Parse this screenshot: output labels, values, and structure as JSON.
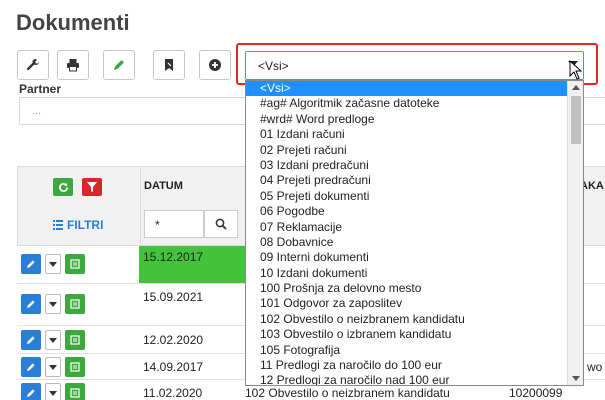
{
  "page": {
    "title": "Dokumenti"
  },
  "toolbar": {
    "buttons": [
      {
        "name": "wrench-icon",
        "color": "#333333"
      },
      {
        "name": "print-icon",
        "color": "#333333"
      },
      {
        "name": "pencil-icon",
        "color": "#3ea83f"
      },
      {
        "name": "bookmark-icon",
        "color": "#333333"
      },
      {
        "name": "plus-circle-icon",
        "color": "#333333"
      }
    ]
  },
  "filters": {
    "partner_label": "Partner",
    "partner_placeholder": "...",
    "doc_type_selected": "<Vsi>"
  },
  "dropdown": {
    "options": [
      "<Vsi>",
      "#ag# Algoritmik začasne datoteke",
      "#wrd# Word predloge",
      "01 Izdani računi",
      "02 Prejeti računi",
      "03 Izdani predračuni",
      "04 Prejeti predračuni",
      "05 Prejeti dokumenti",
      "06 Pogodbe",
      "07 Reklamacije",
      "08 Dobavnice",
      "09 Interni dokumenti",
      "10 Izdani dokumenti",
      "100 Prošnja za delovno mesto",
      "101 Odgovor za zaposlitev",
      "102 Obvestilo o neizbranem kandidatu",
      "103 Obvestilo o izbranem kandidatu",
      "105 Fotografija",
      "11 Predlogi za naročilo do 100 eur",
      "12 Predlogi za naročilo nad 100 eur"
    ],
    "selected_index": 0
  },
  "grid": {
    "filtri_label": "FILTRI",
    "columns": {
      "datum": "DATUM",
      "aka": "AKA"
    },
    "datum_filter_value": "*",
    "rows": [
      {
        "date": "15.12.2017",
        "highlight": true
      },
      {
        "date": "15.09.2021"
      },
      {
        "date": "12.02.2020"
      },
      {
        "date": "14.09.2017",
        "extra": "wo"
      },
      {
        "date": "11.02.2020",
        "doc": "102 Obvestilo o neizbranem kandidatu",
        "number": "10200099"
      }
    ]
  },
  "colors": {
    "accent": "#2a7fd4",
    "green": "#3ea83f",
    "red": "#d9252b",
    "highlight_row": "#43c33b",
    "list_selected": "#1e90ff"
  }
}
